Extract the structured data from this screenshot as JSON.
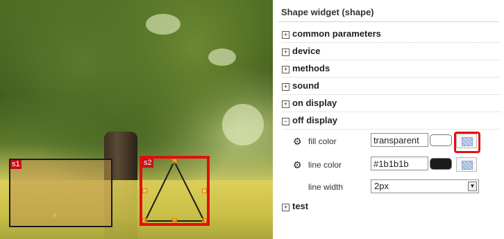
{
  "canvas": {
    "shapes": [
      {
        "label": "s1"
      },
      {
        "label": "s2"
      }
    ]
  },
  "panel": {
    "title": "Shape widget (shape)",
    "sections": {
      "common": {
        "label": "common parameters",
        "toggle": "+"
      },
      "device": {
        "label": "device",
        "toggle": "+"
      },
      "methods": {
        "label": "methods",
        "toggle": "+"
      },
      "sound": {
        "label": "sound",
        "toggle": "+"
      },
      "on_display": {
        "label": "on display",
        "toggle": "+"
      },
      "off_display": {
        "label": "off display",
        "toggle": "−"
      },
      "test": {
        "label": "test",
        "toggle": "+"
      }
    },
    "props": {
      "fill_color": {
        "label": "fill color",
        "value": "transparent",
        "swatch": "#ffffff",
        "icon": "gear-icon"
      },
      "line_color": {
        "label": "line color",
        "value": "#1b1b1b",
        "swatch": "#1b1b1b",
        "icon": "gear-icon"
      },
      "line_width": {
        "label": "line width",
        "value": "2px"
      }
    }
  }
}
